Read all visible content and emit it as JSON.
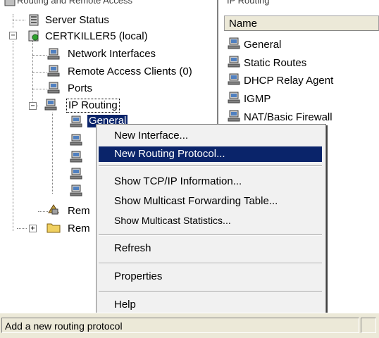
{
  "window": {
    "title_fragment": "Routing and Remote Access"
  },
  "tree": {
    "server_status": "Server Status",
    "server": "CERTKILLER5 (local)",
    "network_interfaces": "Network Interfaces",
    "remote_access_clients": "Remote Access Clients (0)",
    "ports": "Ports",
    "ip_routing": "IP Routing",
    "general": "General",
    "rem1": "Rem",
    "rem2": "Rem"
  },
  "right_pane": {
    "title_fragment": "IP Routing",
    "column_header": "Name",
    "items": [
      "General",
      "Static Routes",
      "DHCP Relay Agent",
      "IGMP",
      "NAT/Basic Firewall"
    ]
  },
  "context_menu": {
    "items": [
      "New Interface...",
      "New Routing Protocol...",
      "Show TCP/IP Information...",
      "Show Multicast Forwarding Table...",
      "Show Multicast Statistics...",
      "Refresh",
      "Properties",
      "Help"
    ],
    "selected": "New Routing Protocol..."
  },
  "status_bar": {
    "text": "Add a new routing protocol"
  },
  "colors": {
    "selection": "#0a246a",
    "menu_bg": "#f1f1f1",
    "chrome": "#ece9d8"
  }
}
